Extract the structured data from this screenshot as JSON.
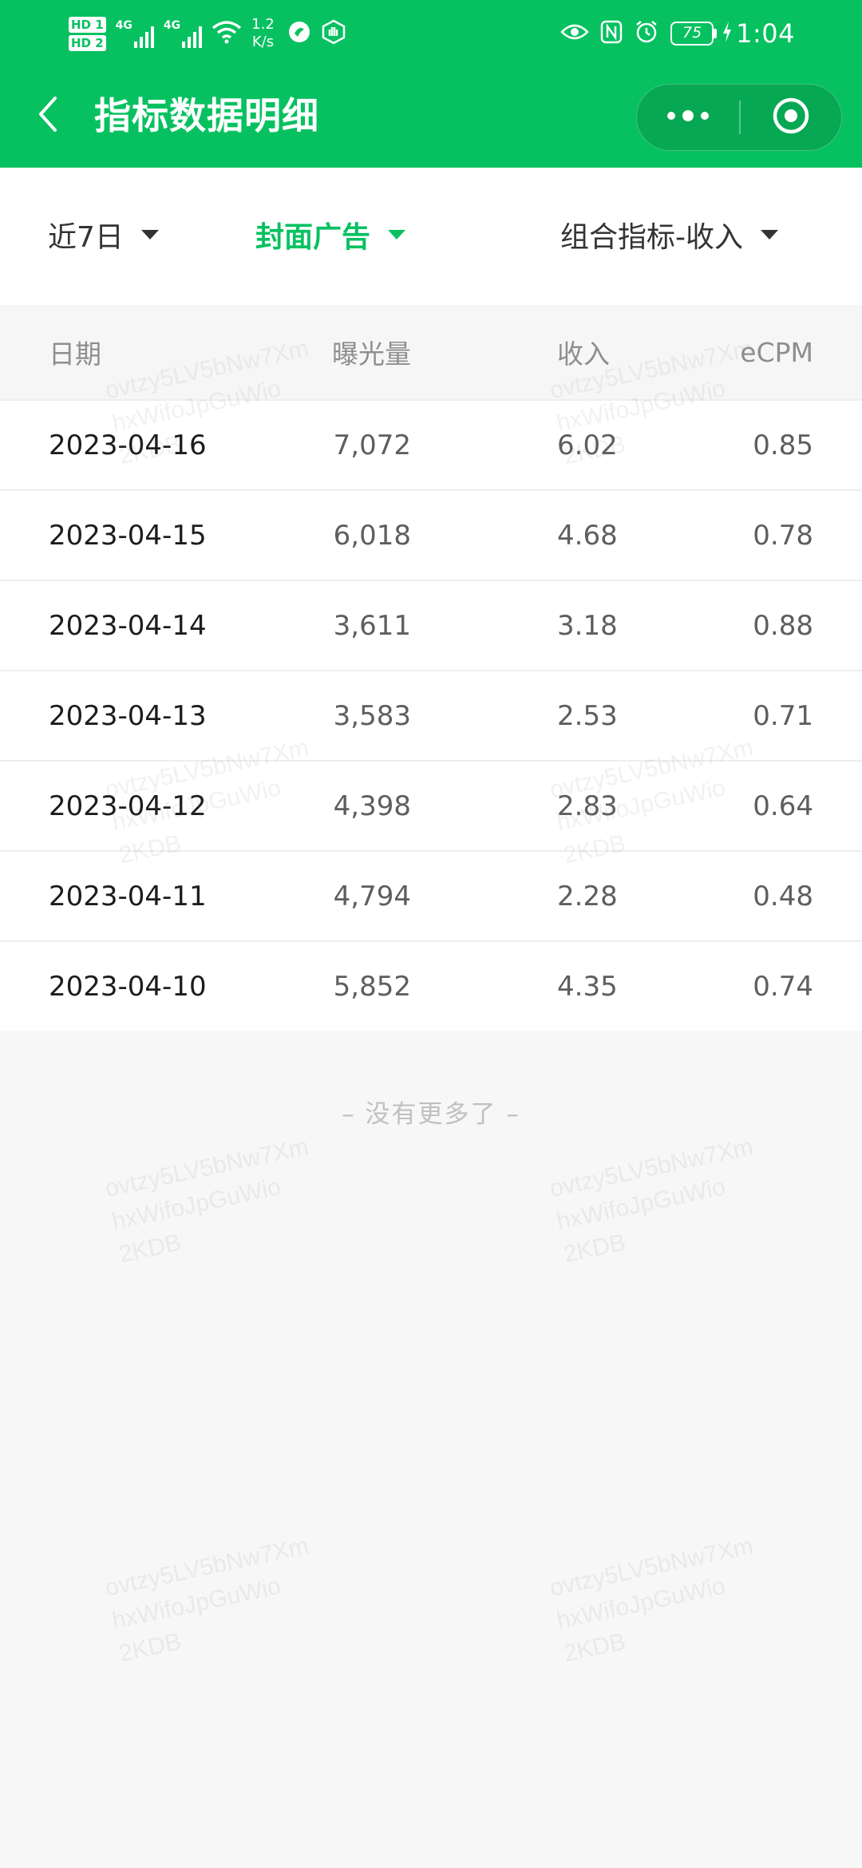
{
  "status_bar": {
    "hd_badges": [
      "HD 1",
      "HD 2"
    ],
    "network_tags": [
      "4G",
      "4G"
    ],
    "speed_value": "1.2",
    "speed_unit": "K/s",
    "battery_level": "75",
    "time": "1:04",
    "left_icons": [
      "wifi-icon",
      "soul-app-icon",
      "hand-shield-icon"
    ],
    "right_icons": [
      "eye-icon",
      "nfc-icon",
      "alarm-icon",
      "battery-icon",
      "charging-bolt-icon"
    ]
  },
  "nav": {
    "title": "指标数据明细",
    "back_icon": "chevron-left-icon",
    "more_icon": "more-dots-icon",
    "close_icon": "target-close-icon"
  },
  "filters": {
    "period": "近7日",
    "ad_type": "封面广告",
    "metric": "组合指标-收入",
    "active_color": "#07c160"
  },
  "table": {
    "headers": [
      "日期",
      "曝光量",
      "收入",
      "eCPM"
    ],
    "rows": [
      [
        "2023-04-16",
        "7,072",
        "6.02",
        "0.85"
      ],
      [
        "2023-04-15",
        "6,018",
        "4.68",
        "0.78"
      ],
      [
        "2023-04-14",
        "3,611",
        "3.18",
        "0.88"
      ],
      [
        "2023-04-13",
        "3,583",
        "2.53",
        "0.71"
      ],
      [
        "2023-04-12",
        "4,398",
        "2.83",
        "0.64"
      ],
      [
        "2023-04-11",
        "4,794",
        "2.28",
        "0.48"
      ],
      [
        "2023-04-10",
        "5,852",
        "4.35",
        "0.74"
      ]
    ]
  },
  "footer": {
    "no_more_text": "– 没有更多了 –"
  },
  "watermark": {
    "text": "ovtzy5LV5bNw7Xm\nhxWifoJpGuWio\n2KDB"
  },
  "theme": {
    "brand_green": "#07c160",
    "page_background": "#f7f7f7"
  }
}
